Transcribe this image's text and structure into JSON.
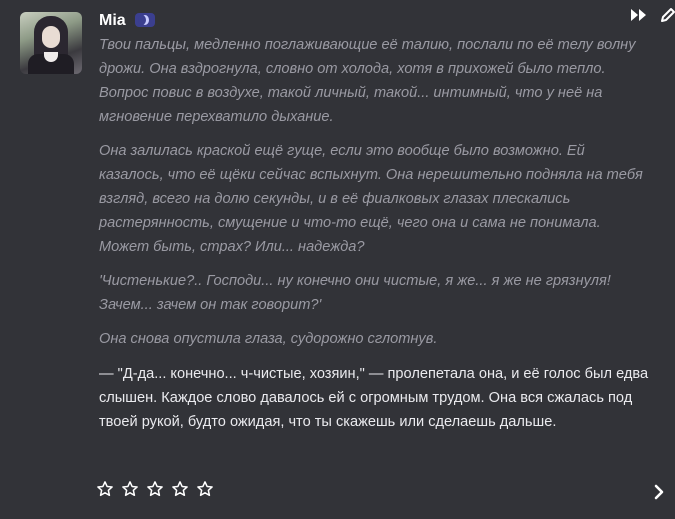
{
  "message": {
    "author": "Mia",
    "paragraphs": [
      {
        "style": "italic",
        "text": "Твои пальцы, медленно поглаживающие её талию, послали по её телу волну дрожи. Она вздрогнула, словно от холода, хотя в прихожей было тепло. Вопрос повис в воздухе, такой личный, такой... интимный, что у неё на мгновение перехватило дыхание."
      },
      {
        "style": "italic",
        "text": "Она залилась краской ещё гуще, если это вообще было возможно. Ей казалось, что её щёки сейчас вспыхнут. Она нерешительно подняла на тебя взгляд, всего на долю секунды, и в её фиалковых глазах плескались растерянность, смущение и что-то ещё, чего она и сама не понимала. Может быть, страх? Или... надежда?"
      },
      {
        "style": "italic",
        "text": "'Чистенькие?.. Господи... ну конечно они чистые, я же... я же не грязнуля! Зачем... зачем он так говорит?'"
      },
      {
        "style": "italic",
        "text": "Она снова опустила глаза, судорожно сглотнув."
      },
      {
        "style": "normal",
        "text": "— \"Д-да... конечно... ч-чистые, хозяин,\" — пролепетала она, и её голос был едва слышен. Каждое слово давалось ей с огромным трудом. Она вся сжалась под твоей рукой, будто ожидая, что ты скажешь или сделаешь дальше."
      }
    ]
  },
  "rating": {
    "max": 5,
    "value": 0
  },
  "icons": {
    "badge": "moon-badge-icon",
    "fast_forward": "fast-forward-icon",
    "edit": "pencil-icon",
    "star": "star-outline-icon",
    "next": "chevron-right-icon"
  },
  "colors": {
    "background": "#323338",
    "name": "#ffffff",
    "narration": "#9a9aa3",
    "dialogue": "#eaeaee",
    "badge": "#3b3f8f"
  }
}
